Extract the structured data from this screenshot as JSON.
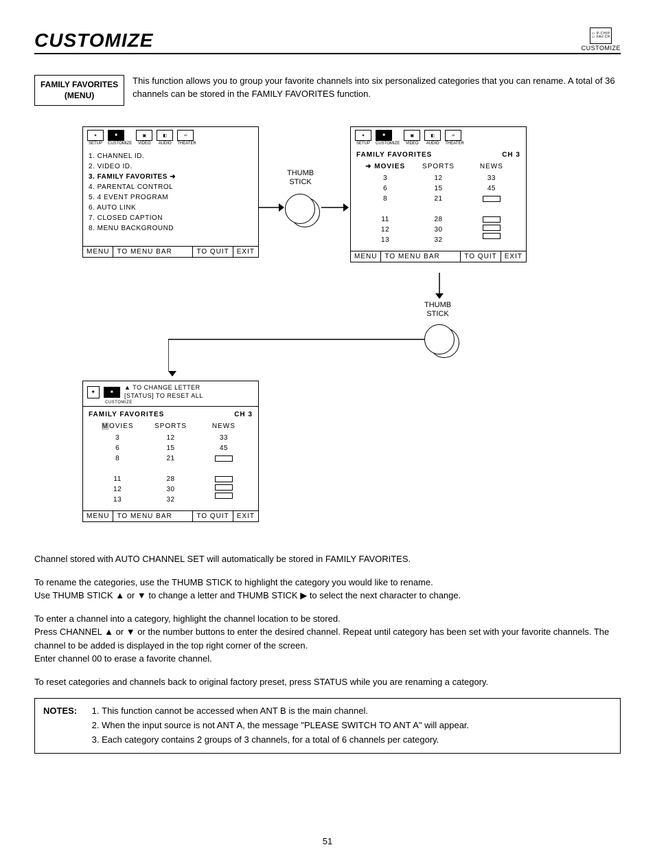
{
  "page": {
    "title": "CUSTOMIZE",
    "corner_label": "CUSTOMIZE",
    "number": "51"
  },
  "section": {
    "label_line1": "FAMILY FAVORITES",
    "label_line2": "(MENU)",
    "intro": "This function allows you to group your favorite channels into six personalized categories that you can rename. A total of 36 channels can be stored in the FAMILY FAVORITES function."
  },
  "iconbar": {
    "setup": "SETUP",
    "customize": "CUSTOMIZE",
    "video": "VIDEO",
    "audio": "AUDIO",
    "theater": "THEATER"
  },
  "osd_footer": {
    "menu": "MENU",
    "to_menu_bar": "TO MENU BAR",
    "to_quit": "TO QUIT",
    "exit": "EXIT"
  },
  "osd1": {
    "items": [
      "1. CHANNEL ID.",
      "2. VIDEO ID.",
      "3. FAMILY FAVORITES",
      "4. PARENTAL CONTROL",
      "5. 4 EVENT PROGRAM",
      "6. AUTO LINK",
      "7. CLOSED CAPTION",
      "8. MENU BACKGROUND"
    ],
    "selected_index": 2
  },
  "favorites": {
    "title": "FAMILY FAVORITES",
    "ch_label": "CH   3",
    "hint1": "TO CHANGE LETTER",
    "hint2": "[STATUS] TO RESET ALL",
    "columns": [
      {
        "name": "MOVIES",
        "rows": [
          "3",
          "6",
          "8",
          "",
          "11",
          "12",
          "13"
        ]
      },
      {
        "name": "SPORTS",
        "rows": [
          "12",
          "15",
          "21",
          "",
          "28",
          "30",
          "32"
        ]
      },
      {
        "name": "NEWS",
        "rows": [
          "33",
          "45",
          "[slot]",
          "",
          "[slot]",
          "[slot]",
          "[slot]"
        ]
      }
    ]
  },
  "thumb": "THUMB\nSTICK",
  "body": {
    "p1": "Channel stored with AUTO CHANNEL SET will automatically be stored in FAMILY FAVORITES.",
    "p2": "To rename the categories, use the THUMB STICK to highlight the category you would like to rename.\nUse THUMB STICK ▲ or ▼ to change a letter and THUMB STICK ▶ to select the next character to change.",
    "p3": "To enter a channel into a category, highlight the channel location to be stored.\nPress CHANNEL ▲ or ▼ or the number buttons to enter the desired channel.  Repeat until category has been set with your favorite channels.  The channel to be added is displayed in the top right corner of the screen.\nEnter channel 00 to erase a favorite channel.",
    "p4": "To reset categories and channels back to original factory preset, press STATUS while you are renaming a category."
  },
  "notes": {
    "label": "NOTES:",
    "items": [
      "This function cannot be accessed when ANT B is the main channel.",
      "When the input source is not ANT A, the message \"PLEASE SWITCH TO ANT A\" will appear.",
      "Each category contains 2 groups of 3 channels, for a total of 6 channels per category."
    ]
  }
}
